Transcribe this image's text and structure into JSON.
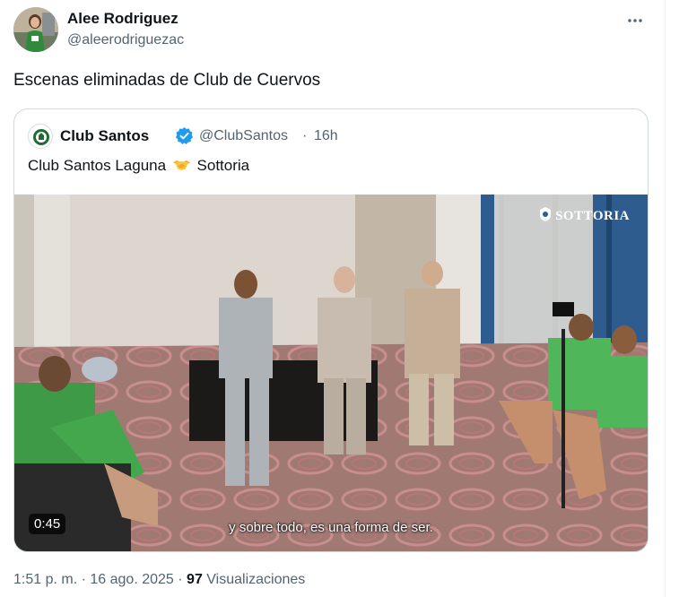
{
  "author": {
    "name": "Alee Rodriguez",
    "handle": "@aleerodriguezac"
  },
  "tweet": {
    "text": "Escenas eliminadas de Club de Cuervos"
  },
  "quoted": {
    "name": "Club Santos",
    "handle": "@ClubSantos",
    "separator": "·",
    "time": "16h",
    "text_before": "Club Santos Laguna",
    "emoji": "handshake-icon",
    "text_after": "Sottoria",
    "video": {
      "watermark": "SOTTORIA",
      "duration": "0:45",
      "subtitle": "y sobre todo, es una forma de ser."
    }
  },
  "footer": {
    "time": "1:51 p. m.",
    "sep1": "·",
    "date": "16 ago. 2025",
    "sep2": "·",
    "views_count": "97",
    "views_label": "Visualizaciones"
  },
  "colors": {
    "text": "#0f1419",
    "muted": "#536471",
    "border": "#cfd9de",
    "verified": "#1d9bf0",
    "jersey": "#3fa648"
  }
}
